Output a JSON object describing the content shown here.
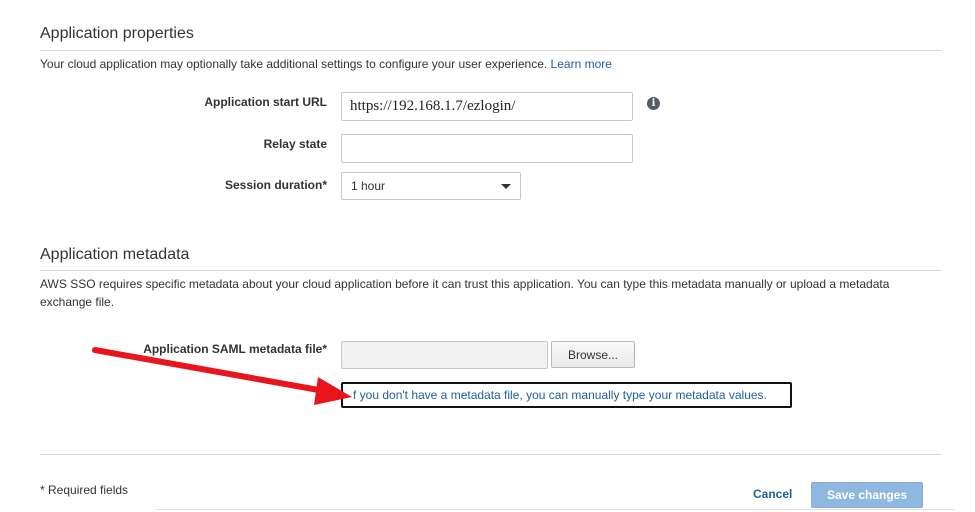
{
  "app_properties": {
    "title": "Application properties",
    "description": "Your cloud application may optionally take additional settings to configure your user experience.",
    "learn_more": "Learn more",
    "start_url": {
      "label": "Application start URL",
      "value": "https://192.168.1.7/ezlogin/"
    },
    "relay_state": {
      "label": "Relay state",
      "value": ""
    },
    "session_duration": {
      "label": "Session duration*",
      "value": "1 hour"
    }
  },
  "app_metadata": {
    "title": "Application metadata",
    "description_line1": "AWS SSO requires specific metadata about your cloud application before it can trust this application. You can type this metadata manually or upload a metadata",
    "description_line2": "exchange file.",
    "saml_file": {
      "label": "Application SAML metadata file*",
      "browse_label": "Browse..."
    },
    "manual_link": "f you don't have a metadata file, you can manually type your metadata values."
  },
  "footer": {
    "required_note": "* Required fields",
    "cancel_label": "Cancel",
    "save_label": "Save changes"
  },
  "colors": {
    "link": "#1d5f9e",
    "save_button_disabled": "#8fb8e0",
    "annotation_arrow": "#e8161b"
  },
  "icons": {
    "start_url_info": "info-icon",
    "session_dropdown": "chevron-down-icon",
    "annotation": "red-arrow-annotation"
  }
}
